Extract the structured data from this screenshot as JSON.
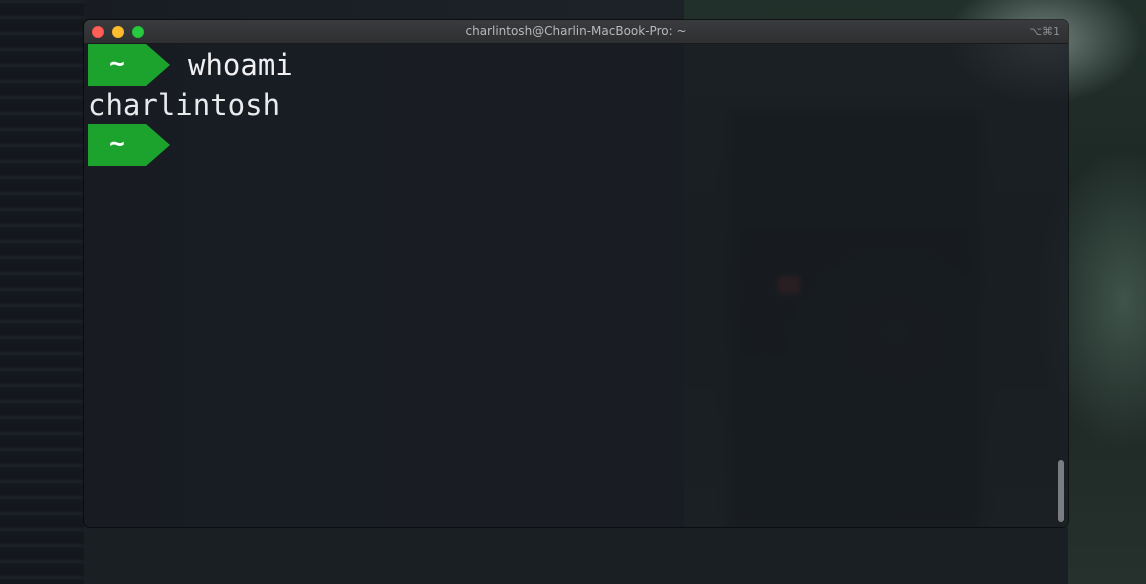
{
  "window": {
    "title": "charlintosh@Charlin-MacBook-Pro: ~",
    "shortcut": "⌥⌘1"
  },
  "terminal": {
    "lines": [
      {
        "prompt": "~",
        "command": "whoami"
      },
      {
        "output": "charlintosh"
      },
      {
        "prompt": "~",
        "command": ""
      }
    ]
  },
  "colors": {
    "prompt_segment": "#1ba32e",
    "text": "#e9eaec",
    "close": "#fe5f57",
    "minimize": "#febc2e",
    "maximize": "#28c840"
  },
  "icons": [
    "close-button",
    "minimize-button",
    "maximize-button"
  ]
}
